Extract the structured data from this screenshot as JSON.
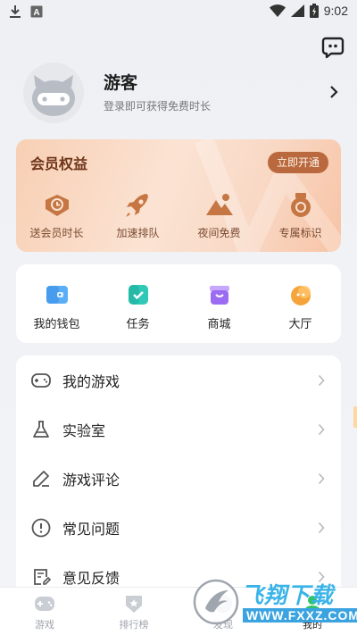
{
  "status_bar": {
    "time": "9:02"
  },
  "profile": {
    "name": "游客",
    "subtitle": "登录即可获得免费时长"
  },
  "vip": {
    "title": "会员权益",
    "open_label": "立即开通",
    "items": [
      {
        "label": "送会员时长",
        "icon": "clock-tag-icon"
      },
      {
        "label": "加速排队",
        "icon": "rocket-icon"
      },
      {
        "label": "夜间免费",
        "icon": "mountain-moon-icon"
      },
      {
        "label": "专属标识",
        "icon": "badge-icon"
      }
    ]
  },
  "quick": [
    {
      "label": "我的钱包",
      "icon": "wallet-icon",
      "color": "#3b9cf0"
    },
    {
      "label": "任务",
      "icon": "task-icon",
      "color": "#27c2b0"
    },
    {
      "label": "商城",
      "icon": "shop-icon",
      "color": "#9b6cf2"
    },
    {
      "label": "大厅",
      "icon": "hall-icon",
      "color": "#f5a43a"
    }
  ],
  "menu": [
    {
      "label": "我的游戏",
      "icon": "gamepad-icon"
    },
    {
      "label": "实验室",
      "icon": "flask-icon"
    },
    {
      "label": "游戏评论",
      "icon": "edit-icon"
    },
    {
      "label": "常见问题",
      "icon": "info-icon"
    },
    {
      "label": "意见反馈",
      "icon": "feedback-icon"
    }
  ],
  "tabs": [
    {
      "label": "游戏",
      "icon": "gamepad-tab-icon",
      "active": false
    },
    {
      "label": "排行榜",
      "icon": "ranking-tab-icon",
      "active": false
    },
    {
      "label": "发现",
      "icon": "discover-tab-icon",
      "active": false
    },
    {
      "label": "我的",
      "icon": "profile-tab-icon",
      "active": true
    }
  ],
  "watermark": {
    "brand": "飞翔下载",
    "url": "WWW.FXXZ.COM"
  }
}
